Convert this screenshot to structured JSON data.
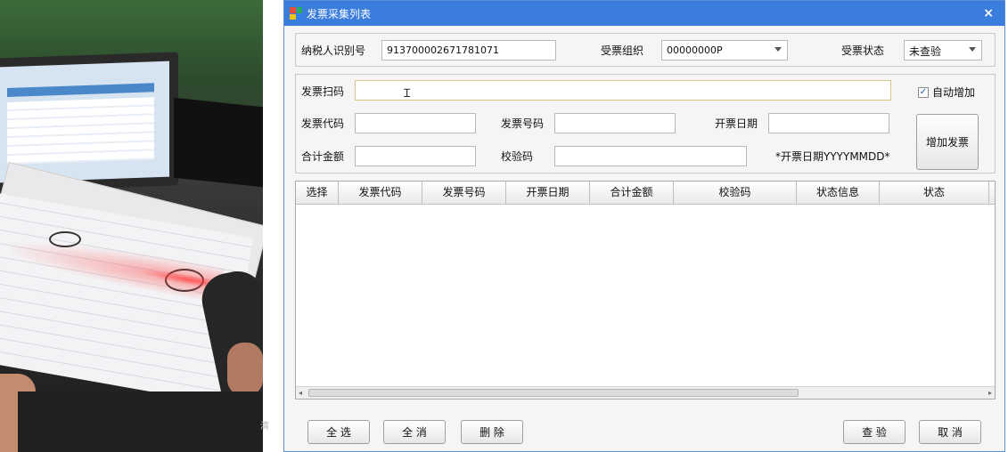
{
  "window": {
    "title": "发票采集列表",
    "close_glyph": "×"
  },
  "row1": {
    "taxpayer_label": "纳税人识别号",
    "taxpayer_value": "913700002671781071",
    "org_label": "受票组织",
    "org_value": "00000000P",
    "status_label": "受票状态",
    "status_value": "未查验"
  },
  "scan": {
    "label": "发票扫码",
    "value": "",
    "auto_add_label": "自动增加",
    "auto_add_checked": "✓"
  },
  "row2": {
    "code_label": "发票代码",
    "number_label": "发票号码",
    "date_label": "开票日期"
  },
  "row3": {
    "amount_label": "合计金额",
    "check_label": "校验码",
    "date_hint": "*开票日期YYYYMMDD*"
  },
  "add_button": "增加发票",
  "table": {
    "columns": [
      "选择",
      "发票代码",
      "发票号码",
      "开票日期",
      "合计金额",
      "校验码",
      "状态信息",
      "状态"
    ]
  },
  "footer": {
    "select_all": "全 选",
    "clear_all": "全 消",
    "delete": "删 除",
    "verify": "查 验",
    "cancel": "取 消"
  },
  "photo_caption_char": "清",
  "colors": {
    "titlebar": "#3b7ddd",
    "icon_tiles": [
      "#e84c3d",
      "#27ae60",
      "#f1c40f",
      "#2f80ed"
    ]
  }
}
